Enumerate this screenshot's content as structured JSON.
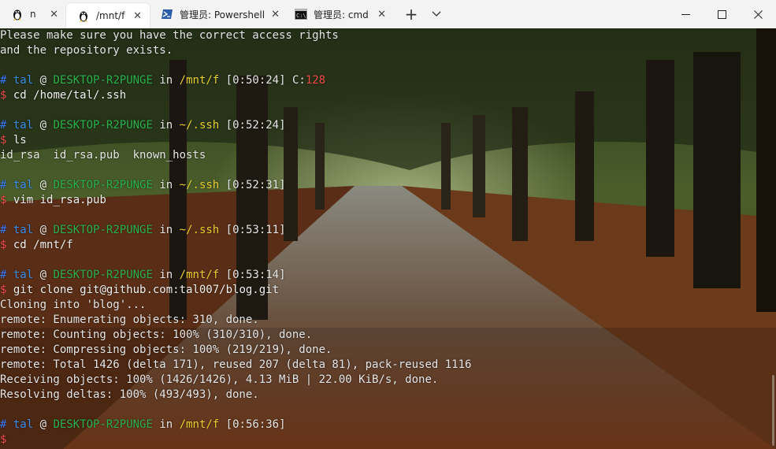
{
  "tabs": [
    {
      "title": "n",
      "icon": "linux-penguin-icon",
      "active": false
    },
    {
      "title": "/mnt/f",
      "icon": "linux-penguin-icon",
      "active": true
    },
    {
      "title": "管理员: Powershell",
      "icon": "powershell-icon",
      "active": false
    },
    {
      "title": "管理员: cmd",
      "icon": "cmd-icon",
      "active": false
    }
  ],
  "tabbar": {
    "new_tab": "+",
    "dropdown": "chevron-down-icon",
    "close_glyph": "✕",
    "minimize": "minimize-icon",
    "maximize": "maximize-icon",
    "close": "close-icon"
  },
  "prompt": {
    "hash": "#",
    "user": "tal",
    "at": "@",
    "host": "DESKTOP-R2PUNGE",
    "in": "in",
    "dollar": "$"
  },
  "terminal": {
    "l0": "Please make sure you have the correct access rights",
    "l1": "and the repository exists.",
    "p1_path": "/mnt/f",
    "p1_time": "[0:50:24]",
    "p1_code_label": "C:",
    "p1_code": "128",
    "c1": "cd /home/tal/.ssh",
    "p2_path": "~/.ssh",
    "p2_time": "[0:52:24]",
    "c2": "ls",
    "o2": "id_rsa  id_rsa.pub  known_hosts",
    "p3_path": "~/.ssh",
    "p3_time": "[0:52:31]",
    "c3": "vim id_rsa.pub",
    "p4_path": "~/.ssh",
    "p4_time": "[0:53:11]",
    "c4": "cd /mnt/f",
    "p5_path": "/mnt/f",
    "p5_time": "[0:53:14]",
    "c5": "git clone git@github.com:tal007/blog.git",
    "o5_1": "Cloning into 'blog'...",
    "o5_2": "remote: Enumerating objects: 310, done.",
    "o5_3": "remote: Counting objects: 100% (310/310), done.",
    "o5_4": "remote: Compressing objects: 100% (219/219), done.",
    "o5_5": "remote: Total 1426 (delta 171), reused 207 (delta 81), pack-reused 1116",
    "o5_6": "Receiving objects: 100% (1426/1426), 4.13 MiB | 22.00 KiB/s, done.",
    "o5_7": "Resolving deltas: 100% (493/493), done.",
    "p6_path": "/mnt/f",
    "p6_time": "[0:56:36]"
  },
  "colors": {
    "user": "#3b8eea",
    "host": "#2bb24c",
    "path": "#e9d02f",
    "error": "#f14c4c"
  }
}
